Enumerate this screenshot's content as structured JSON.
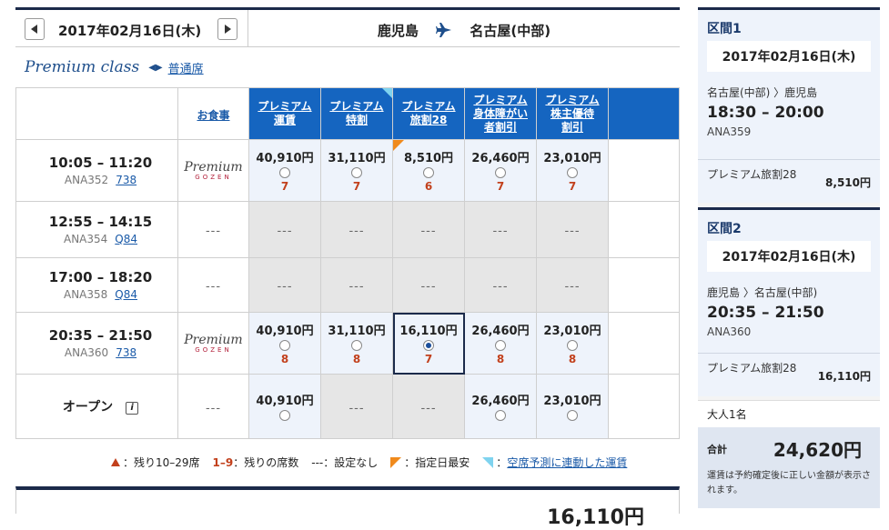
{
  "search": {
    "date": "2017年02月16日(木)",
    "origin": "鹿児島",
    "destination": "名古屋(中部)",
    "class_label": "Premium class",
    "alt_class_link": "普通席"
  },
  "table": {
    "meal_header": "お食事",
    "fare_headers": [
      {
        "line1": "プレミアム",
        "line2": "運賃",
        "line3": "",
        "corner": false
      },
      {
        "line1": "プレミアム",
        "line2": "特割",
        "line3": "",
        "corner": true
      },
      {
        "line1": "プレミアム",
        "line2": "旅割28",
        "line3": "",
        "corner": false
      },
      {
        "line1": "プレミアム",
        "line2": "身体障がい",
        "line3": "者割引",
        "corner": false
      },
      {
        "line1": "プレミアム",
        "line2": "株主優待",
        "line3": "割引",
        "corner": false
      }
    ],
    "meal_logo": {
      "word": "Premium",
      "sub": "GOZEN"
    },
    "na_text": "---",
    "rows": [
      {
        "time": "10:05 – 11:20",
        "flight": "ANA352",
        "aircraft": "738",
        "meal": true,
        "fares": [
          {
            "price": "40,910円",
            "seats": "7",
            "checked": false
          },
          {
            "price": "31,110円",
            "seats": "7",
            "checked": false
          },
          {
            "price": "8,510円",
            "seats": "6",
            "checked": false,
            "orange": true
          },
          {
            "price": "26,460円",
            "seats": "7",
            "checked": false
          },
          {
            "price": "23,010円",
            "seats": "7",
            "checked": false
          }
        ]
      },
      {
        "time": "12:55 – 14:15",
        "flight": "ANA354",
        "aircraft": "Q84",
        "meal": false,
        "fares": [
          null,
          null,
          null,
          null,
          null
        ]
      },
      {
        "time": "17:00 – 18:20",
        "flight": "ANA358",
        "aircraft": "Q84",
        "meal": false,
        "fares": [
          null,
          null,
          null,
          null,
          null
        ]
      },
      {
        "time": "20:35 – 21:50",
        "flight": "ANA360",
        "aircraft": "738",
        "meal": true,
        "fares": [
          {
            "price": "40,910円",
            "seats": "8",
            "checked": false
          },
          {
            "price": "31,110円",
            "seats": "8",
            "checked": false
          },
          {
            "price": "16,110円",
            "seats": "7",
            "checked": true,
            "selected": true
          },
          {
            "price": "26,460円",
            "seats": "8",
            "checked": false
          },
          {
            "price": "23,010円",
            "seats": "8",
            "checked": false
          }
        ]
      }
    ],
    "open_row": {
      "label": "オープン",
      "info_icon": "i",
      "fares": [
        {
          "price": "40,910円",
          "seats": "",
          "checked": false
        },
        null,
        null,
        {
          "price": "26,460円",
          "seats": "",
          "checked": false
        },
        {
          "price": "23,010円",
          "seats": "",
          "checked": false
        }
      ]
    }
  },
  "legend": {
    "remain_range": "：残り10–29席",
    "seat_count_key": "1–9",
    "seat_count_desc": "：残りの席数",
    "none_key": "---",
    "none_desc": "：設定なし",
    "lowest_desc": "：指定日最安",
    "linked_link": "空席予測に連動した運賃"
  },
  "total_bar": {
    "amount": "16,110円"
  },
  "sidebar": {
    "segments": [
      {
        "title": "区間1",
        "date": "2017年02月16日(木)",
        "route": "名古屋(中部) 〉鹿児島",
        "time": "18:30 – 20:00",
        "flight": "ANA359",
        "fare_name": "プレミアム旅割28",
        "fare_price": "8,510円"
      },
      {
        "title": "区間2",
        "date": "2017年02月16日(木)",
        "route": "鹿児島 〉名古屋(中部)",
        "time": "20:35 – 21:50",
        "flight": "ANA360",
        "fare_name": "プレミアム旅割28",
        "fare_price": "16,110円"
      }
    ],
    "passengers": "大人1名",
    "total_label": "合計",
    "total_amount": "24,620円",
    "total_note": "運賃は予約確定後に正しい金額が表示されます。"
  },
  "colors": {
    "header_blue": "#1565c0",
    "navy": "#1b2a4a",
    "seat_red": "#c2401c",
    "lowest_orange": "#f08a1c",
    "linked_cyan": "#7fd3ef"
  },
  "icons": {
    "prev": "chevron-left-icon",
    "next": "chevron-right-icon",
    "plane": "airplane-icon",
    "swap": "swap-arrows-icon",
    "info": "info-icon"
  }
}
